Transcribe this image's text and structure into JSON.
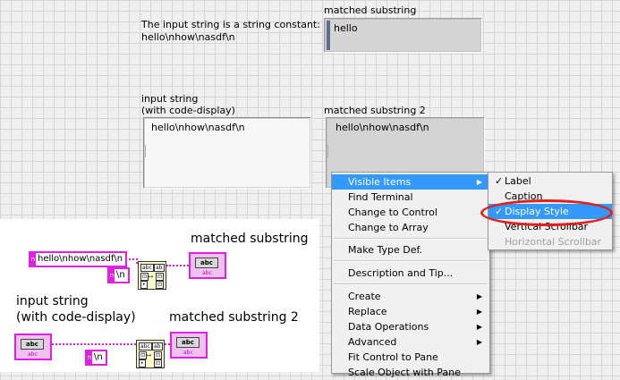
{
  "front_panel": {
    "note_line1": "The input string is a string constant:",
    "note_line2": "hello\\nhow\\nasdf\\n",
    "matched_label": "matched substring",
    "matched_value": "hello",
    "input_label_1": "input string",
    "input_label_2": "(with code-display)",
    "input_value": "hello\\nhow\\nasdf\\n",
    "matched2_label": "matched substring 2",
    "matched2_value": "hello\\nhow\\nasdf\\n"
  },
  "block_diagram": {
    "const_string": "hello\\nhow\\nasdf\\n",
    "const_n_1": "\\n",
    "const_n_2": "\\n",
    "matched_label": "matched substring",
    "input_label_1": "input string",
    "input_label_2": "(with code-display)",
    "matched2_label": "matched substring 2",
    "term_text": "abc",
    "term_sub": "abc"
  },
  "context_menu": {
    "items": [
      "Visible Items",
      "Find Terminal",
      "Change to Control",
      "Change to Array",
      "Make Type Def.",
      "Description and Tip...",
      "Create",
      "Replace",
      "Data Operations",
      "Advanced",
      "Fit Control to Pane",
      "Scale Object with Pane"
    ]
  },
  "submenu": {
    "items": [
      "Label",
      "Caption",
      "Display Style",
      "Vertical Scrollbar",
      "Horizontal Scrollbar"
    ],
    "checked": [
      "Label",
      "Display Style"
    ],
    "highlighted": "Display Style",
    "disabled": [
      "Horizontal Scrollbar"
    ]
  },
  "colors": {
    "highlight": "#3399ff",
    "annotation_ellipse": "#e0201e",
    "string_wire": "#e020e0"
  }
}
